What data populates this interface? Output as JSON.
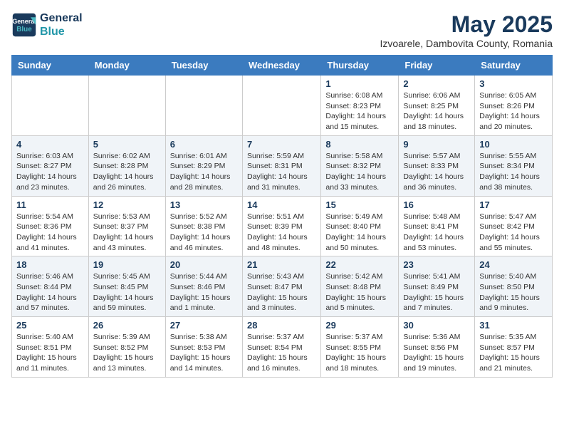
{
  "header": {
    "logo_line1": "General",
    "logo_line2": "Blue",
    "month_year": "May 2025",
    "location": "Izvoarele, Dambovita County, Romania"
  },
  "weekdays": [
    "Sunday",
    "Monday",
    "Tuesday",
    "Wednesday",
    "Thursday",
    "Friday",
    "Saturday"
  ],
  "weeks": [
    [
      {
        "day": "",
        "info": ""
      },
      {
        "day": "",
        "info": ""
      },
      {
        "day": "",
        "info": ""
      },
      {
        "day": "",
        "info": ""
      },
      {
        "day": "1",
        "info": "Sunrise: 6:08 AM\nSunset: 8:23 PM\nDaylight: 14 hours\nand 15 minutes."
      },
      {
        "day": "2",
        "info": "Sunrise: 6:06 AM\nSunset: 8:25 PM\nDaylight: 14 hours\nand 18 minutes."
      },
      {
        "day": "3",
        "info": "Sunrise: 6:05 AM\nSunset: 8:26 PM\nDaylight: 14 hours\nand 20 minutes."
      }
    ],
    [
      {
        "day": "4",
        "info": "Sunrise: 6:03 AM\nSunset: 8:27 PM\nDaylight: 14 hours\nand 23 minutes."
      },
      {
        "day": "5",
        "info": "Sunrise: 6:02 AM\nSunset: 8:28 PM\nDaylight: 14 hours\nand 26 minutes."
      },
      {
        "day": "6",
        "info": "Sunrise: 6:01 AM\nSunset: 8:29 PM\nDaylight: 14 hours\nand 28 minutes."
      },
      {
        "day": "7",
        "info": "Sunrise: 5:59 AM\nSunset: 8:31 PM\nDaylight: 14 hours\nand 31 minutes."
      },
      {
        "day": "8",
        "info": "Sunrise: 5:58 AM\nSunset: 8:32 PM\nDaylight: 14 hours\nand 33 minutes."
      },
      {
        "day": "9",
        "info": "Sunrise: 5:57 AM\nSunset: 8:33 PM\nDaylight: 14 hours\nand 36 minutes."
      },
      {
        "day": "10",
        "info": "Sunrise: 5:55 AM\nSunset: 8:34 PM\nDaylight: 14 hours\nand 38 minutes."
      }
    ],
    [
      {
        "day": "11",
        "info": "Sunrise: 5:54 AM\nSunset: 8:36 PM\nDaylight: 14 hours\nand 41 minutes."
      },
      {
        "day": "12",
        "info": "Sunrise: 5:53 AM\nSunset: 8:37 PM\nDaylight: 14 hours\nand 43 minutes."
      },
      {
        "day": "13",
        "info": "Sunrise: 5:52 AM\nSunset: 8:38 PM\nDaylight: 14 hours\nand 46 minutes."
      },
      {
        "day": "14",
        "info": "Sunrise: 5:51 AM\nSunset: 8:39 PM\nDaylight: 14 hours\nand 48 minutes."
      },
      {
        "day": "15",
        "info": "Sunrise: 5:49 AM\nSunset: 8:40 PM\nDaylight: 14 hours\nand 50 minutes."
      },
      {
        "day": "16",
        "info": "Sunrise: 5:48 AM\nSunset: 8:41 PM\nDaylight: 14 hours\nand 53 minutes."
      },
      {
        "day": "17",
        "info": "Sunrise: 5:47 AM\nSunset: 8:42 PM\nDaylight: 14 hours\nand 55 minutes."
      }
    ],
    [
      {
        "day": "18",
        "info": "Sunrise: 5:46 AM\nSunset: 8:44 PM\nDaylight: 14 hours\nand 57 minutes."
      },
      {
        "day": "19",
        "info": "Sunrise: 5:45 AM\nSunset: 8:45 PM\nDaylight: 14 hours\nand 59 minutes."
      },
      {
        "day": "20",
        "info": "Sunrise: 5:44 AM\nSunset: 8:46 PM\nDaylight: 15 hours\nand 1 minute."
      },
      {
        "day": "21",
        "info": "Sunrise: 5:43 AM\nSunset: 8:47 PM\nDaylight: 15 hours\nand 3 minutes."
      },
      {
        "day": "22",
        "info": "Sunrise: 5:42 AM\nSunset: 8:48 PM\nDaylight: 15 hours\nand 5 minutes."
      },
      {
        "day": "23",
        "info": "Sunrise: 5:41 AM\nSunset: 8:49 PM\nDaylight: 15 hours\nand 7 minutes."
      },
      {
        "day": "24",
        "info": "Sunrise: 5:40 AM\nSunset: 8:50 PM\nDaylight: 15 hours\nand 9 minutes."
      }
    ],
    [
      {
        "day": "25",
        "info": "Sunrise: 5:40 AM\nSunset: 8:51 PM\nDaylight: 15 hours\nand 11 minutes."
      },
      {
        "day": "26",
        "info": "Sunrise: 5:39 AM\nSunset: 8:52 PM\nDaylight: 15 hours\nand 13 minutes."
      },
      {
        "day": "27",
        "info": "Sunrise: 5:38 AM\nSunset: 8:53 PM\nDaylight: 15 hours\nand 14 minutes."
      },
      {
        "day": "28",
        "info": "Sunrise: 5:37 AM\nSunset: 8:54 PM\nDaylight: 15 hours\nand 16 minutes."
      },
      {
        "day": "29",
        "info": "Sunrise: 5:37 AM\nSunset: 8:55 PM\nDaylight: 15 hours\nand 18 minutes."
      },
      {
        "day": "30",
        "info": "Sunrise: 5:36 AM\nSunset: 8:56 PM\nDaylight: 15 hours\nand 19 minutes."
      },
      {
        "day": "31",
        "info": "Sunrise: 5:35 AM\nSunset: 8:57 PM\nDaylight: 15 hours\nand 21 minutes."
      }
    ]
  ]
}
